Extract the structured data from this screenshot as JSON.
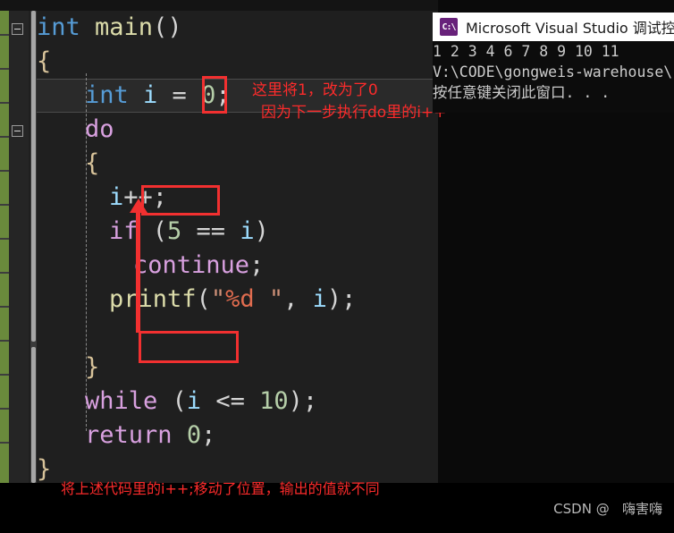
{
  "editor": {
    "name": "visual-studio-code-editor",
    "theme_background": "#1f1f1f",
    "change_bar_color": "#6a8a3c",
    "lines": [
      {
        "indent": 0,
        "segments": [
          {
            "t": "int ",
            "c": "type"
          },
          {
            "t": "main",
            "c": "fn"
          },
          {
            "t": "()",
            "c": "punc"
          }
        ]
      },
      {
        "indent": 0,
        "segments": [
          {
            "t": "{",
            "c": "brace"
          }
        ]
      },
      {
        "indent": 2,
        "segments": [
          {
            "t": "int ",
            "c": "type"
          },
          {
            "t": "i",
            "c": "var"
          },
          {
            "t": " = ",
            "c": "op"
          },
          {
            "t": "0",
            "c": "num"
          },
          {
            "t": ";",
            "c": "punc"
          }
        ]
      },
      {
        "indent": 2,
        "segments": [
          {
            "t": "do",
            "c": "kw"
          }
        ]
      },
      {
        "indent": 2,
        "segments": [
          {
            "t": "{",
            "c": "brace"
          }
        ]
      },
      {
        "indent": 3,
        "segments": [
          {
            "t": "i",
            "c": "var"
          },
          {
            "t": "++;",
            "c": "punc"
          }
        ]
      },
      {
        "indent": 3,
        "segments": [
          {
            "t": "if",
            "c": "kw"
          },
          {
            "t": " (",
            "c": "punc"
          },
          {
            "t": "5",
            "c": "num"
          },
          {
            "t": " == ",
            "c": "op"
          },
          {
            "t": "i",
            "c": "var"
          },
          {
            "t": ")",
            "c": "punc"
          }
        ]
      },
      {
        "indent": 4,
        "segments": [
          {
            "t": "continue",
            "c": "kw"
          },
          {
            "t": ";",
            "c": "punc"
          }
        ]
      },
      {
        "indent": 3,
        "segments": [
          {
            "t": "printf",
            "c": "fn"
          },
          {
            "t": "(",
            "c": "punc"
          },
          {
            "t": "\"",
            "c": "str"
          },
          {
            "t": "%d",
            "c": "fmt"
          },
          {
            "t": " \"",
            "c": "str"
          },
          {
            "t": ", ",
            "c": "punc"
          },
          {
            "t": "i",
            "c": "var"
          },
          {
            "t": ");",
            "c": "punc"
          }
        ]
      },
      {
        "indent": 2,
        "segments": []
      },
      {
        "indent": 2,
        "segments": [
          {
            "t": "}",
            "c": "brace"
          }
        ]
      },
      {
        "indent": 2,
        "segments": [
          {
            "t": "while",
            "c": "kw"
          },
          {
            "t": " (",
            "c": "punc"
          },
          {
            "t": "i",
            "c": "var"
          },
          {
            "t": " <= ",
            "c": "op"
          },
          {
            "t": "10",
            "c": "num"
          },
          {
            "t": ");",
            "c": "punc"
          }
        ]
      },
      {
        "indent": 2,
        "segments": [
          {
            "t": "return",
            "c": "kw"
          },
          {
            "t": " ",
            "c": "punc"
          },
          {
            "t": "0",
            "c": "num"
          },
          {
            "t": ";",
            "c": "punc"
          }
        ]
      },
      {
        "indent": 0,
        "segments": [
          {
            "t": "}",
            "c": "brace"
          }
        ]
      }
    ]
  },
  "annotations": {
    "init_note_line1": "这里将1，改为了0",
    "init_note_line2": "因为下一步执行do里的i++",
    "bottom_note": "将上述代码里的i++;移动了位置，输出的值就不同",
    "highlight_color": "#f23030"
  },
  "console": {
    "title": "Microsoft Visual Studio 调试控制台",
    "icon_label": "C:\\",
    "output_lines": [
      "1 2 3 4 6 7 8 9 10 11",
      "V:\\CODE\\gongweis-warehouse\\",
      "按任意键关闭此窗口. . ."
    ]
  },
  "watermark": {
    "text": "CSDN @   嗨害嗨"
  }
}
